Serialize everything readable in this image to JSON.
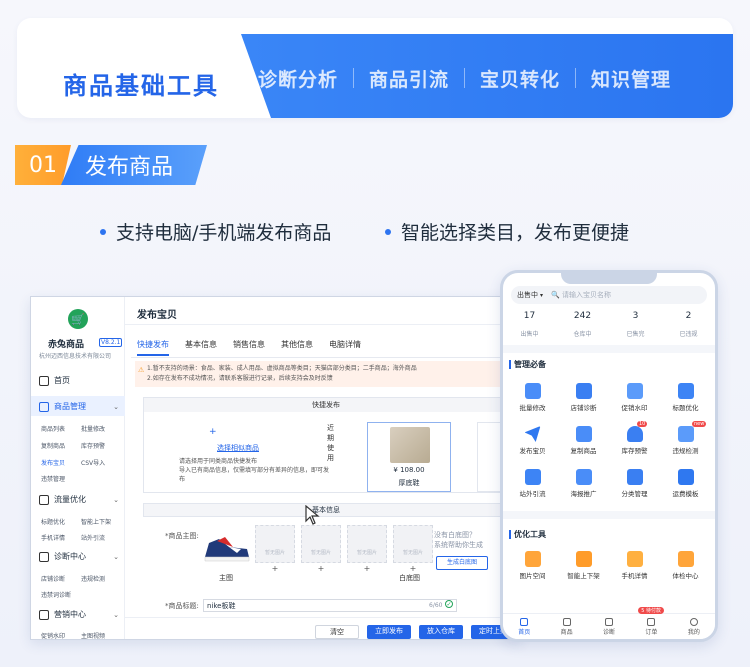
{
  "top_nav": {
    "active": "商品基础工具",
    "tabs": [
      "诊断分析",
      "商品引流",
      "宝贝转化",
      "知识管理"
    ]
  },
  "section": {
    "number": "01",
    "title": "发布商品"
  },
  "bullets": [
    "支持电脑/手机端发布商品",
    "智能选择类目，发布更便捷"
  ],
  "desktop": {
    "shop_name": "赤兔商品",
    "version": "V8.2.1",
    "company": "杭州迈西信息技术有限公司",
    "menu": {
      "home": "首页",
      "goods_mgmt": "商品管理",
      "goods_subs": [
        "商品列表",
        "批量修改",
        "复制商品",
        "库存预警",
        "发布宝贝",
        "CSV导入",
        "违禁管理"
      ],
      "traffic": "流量优化",
      "traffic_subs": [
        "标题优化",
        "智能上下架",
        "手机详情",
        "站外引流"
      ],
      "diag": "诊断中心",
      "diag_subs": [
        "店铺诊断",
        "违规检测",
        "违禁词诊断"
      ],
      "marketing": "营销中心",
      "marketing_subs": [
        "促销水印",
        "主图视频"
      ]
    },
    "page_title": "发布宝贝",
    "tabs": [
      "快捷发布",
      "基本信息",
      "销售信息",
      "其他信息",
      "电脑详情"
    ],
    "warning_lines": [
      "1.暂不支持的场景：食品、家装、成人用品、虚拟商品等类目；天猫店部分类目；二手商品；海外商品",
      "2.如存在发布不成功情况，请联系客服进行记录，后续支持会及时反馈"
    ],
    "quick_publish": {
      "header": "快捷发布",
      "plus": "+",
      "select_label": "选择相似商品",
      "desc_1": "请选择用于同类商品快捷发布",
      "desc_2": "导入已有商品信息，仅需填写部分有差异的信息，即可发布",
      "recent_label": "近期使用",
      "product_price": "¥ 108.00",
      "product_name": "厚底鞋"
    },
    "basic_info": {
      "header": "基本信息",
      "main_image_label": "*商品主图:",
      "placeholder_text": "暂无图片",
      "main_caption": "主图",
      "plus": "+",
      "white_caption": "白底图",
      "tip_1": "没有白底图？",
      "tip_2": "系统帮助你生成",
      "gen_button": "生成白底图",
      "title_label": "*商品标题:",
      "title_value": "nike板鞋",
      "title_count": "6/60"
    },
    "footer_buttons": [
      "清空",
      "立即发布",
      "放入仓库",
      "定时上架"
    ]
  },
  "phone": {
    "status_select": "出售中",
    "search_placeholder": "请输入宝贝名称",
    "stats": [
      {
        "value": "17",
        "label": "出售中"
      },
      {
        "value": "242",
        "label": "仓库中"
      },
      {
        "value": "3",
        "label": "已售完"
      },
      {
        "value": "2",
        "label": "已违规"
      }
    ],
    "section1": "管理必备",
    "tools1": [
      "批量修改",
      "店铺诊断",
      "促销水印",
      "标题优化",
      "发布宝贝",
      "复制商品",
      "库存预警",
      "违规检测",
      "站外引流",
      "海报推广",
      "分类管理",
      "运费模板"
    ],
    "badge_10": "10",
    "badge_new": "new",
    "section2": "优化工具",
    "tools2": [
      "图片空间",
      "智能上下架",
      "手机详情",
      "体检中心"
    ],
    "tabbar": [
      "首页",
      "商品",
      "诊断",
      "订单",
      "我的"
    ],
    "pending_badge": "5 待付款",
    "colors": {
      "accent": "#2465e8",
      "orange": "#ff9c2a"
    }
  }
}
